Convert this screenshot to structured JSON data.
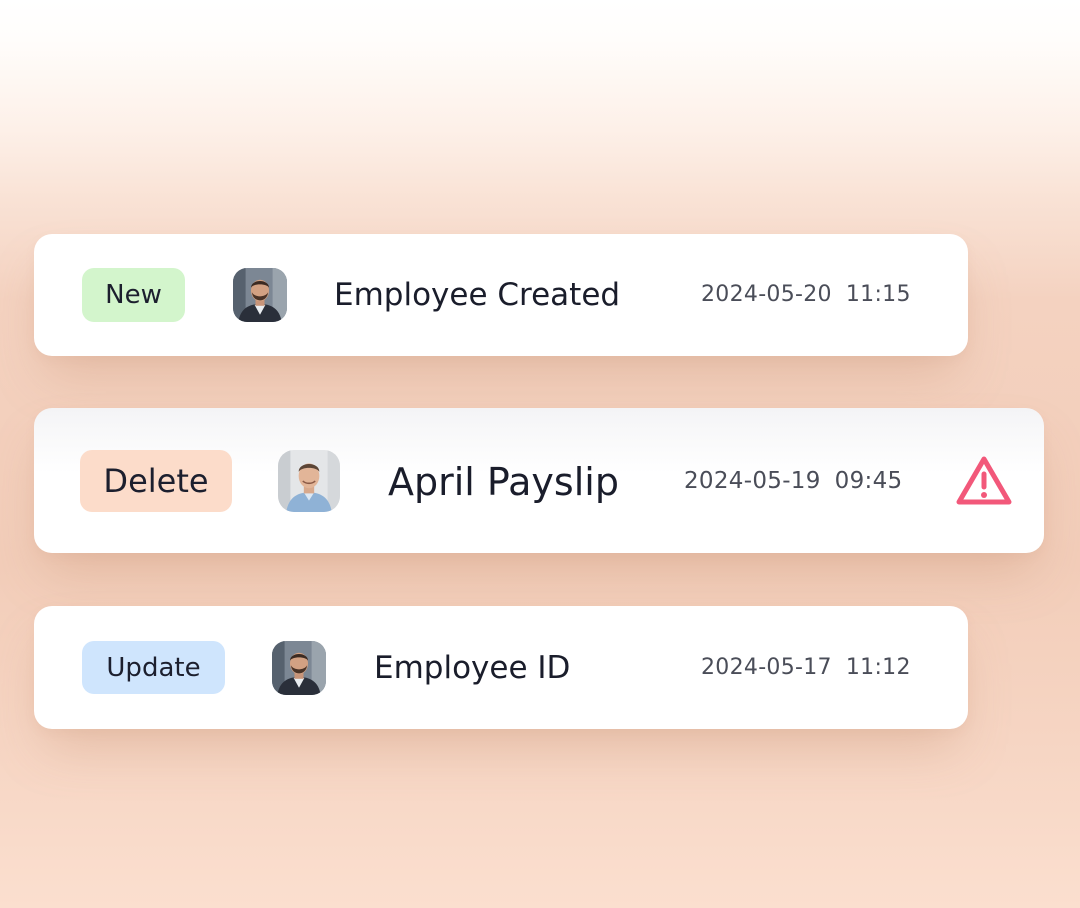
{
  "events": [
    {
      "badge_label": "New",
      "badge_color": "#d3f5cc",
      "avatar_icon": "man-beard-avatar",
      "title": "Employee Created",
      "date": "2024-05-20",
      "time": "11:15"
    },
    {
      "badge_label": "Delete",
      "badge_color": "#fcdcca",
      "avatar_icon": "man-smiling-avatar",
      "title": "April Payslip",
      "date": "2024-05-19",
      "time": "09:45",
      "alert_icon": "warning-triangle-icon",
      "alert_color": "#f2587a"
    },
    {
      "badge_label": "Update",
      "badge_color": "#cfe5fd",
      "avatar_icon": "man-beard-avatar",
      "title": "Employee ID",
      "date": "2024-05-17",
      "time": "11:12"
    }
  ]
}
